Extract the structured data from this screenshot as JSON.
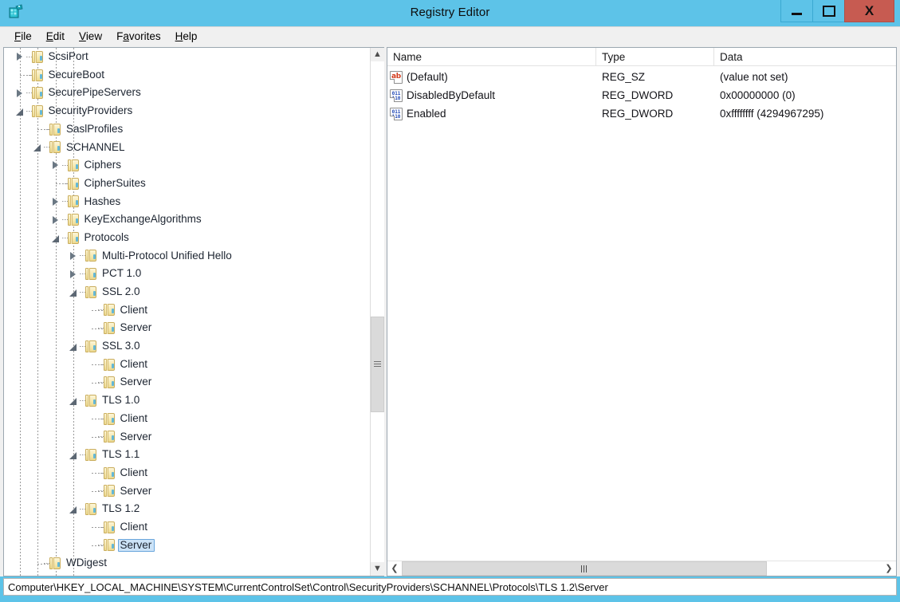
{
  "window": {
    "title": "Registry Editor",
    "app_icon": "regedit-icon",
    "controls": {
      "minimize": "minimize-button",
      "maximize": "maximize-button",
      "close": "X"
    },
    "accent_color": "#5dc3e8",
    "close_color": "#c75b51"
  },
  "menubar": {
    "items": [
      {
        "label": "File",
        "accel": "F"
      },
      {
        "label": "Edit",
        "accel": "E"
      },
      {
        "label": "View",
        "accel": "V"
      },
      {
        "label": "Favorites",
        "accel": "a"
      },
      {
        "label": "Help",
        "accel": "H"
      }
    ]
  },
  "tree": {
    "nodes": [
      {
        "label": "ScsiPort",
        "depth": 3,
        "state": "collapsed",
        "selected": false
      },
      {
        "label": "SecureBoot",
        "depth": 3,
        "state": "leaf",
        "selected": false
      },
      {
        "label": "SecurePipeServers",
        "depth": 3,
        "state": "collapsed",
        "selected": false
      },
      {
        "label": "SecurityProviders",
        "depth": 3,
        "state": "expanded",
        "selected": false
      },
      {
        "label": "SaslProfiles",
        "depth": 4,
        "state": "leaf",
        "selected": false
      },
      {
        "label": "SCHANNEL",
        "depth": 4,
        "state": "expanded",
        "selected": false
      },
      {
        "label": "Ciphers",
        "depth": 5,
        "state": "collapsed",
        "selected": false
      },
      {
        "label": "CipherSuites",
        "depth": 5,
        "state": "leaf",
        "selected": false
      },
      {
        "label": "Hashes",
        "depth": 5,
        "state": "collapsed",
        "selected": false
      },
      {
        "label": "KeyExchangeAlgorithms",
        "depth": 5,
        "state": "collapsed",
        "selected": false
      },
      {
        "label": "Protocols",
        "depth": 5,
        "state": "expanded",
        "selected": false
      },
      {
        "label": "Multi-Protocol Unified Hello",
        "depth": 6,
        "state": "collapsed",
        "selected": false
      },
      {
        "label": "PCT 1.0",
        "depth": 6,
        "state": "collapsed",
        "selected": false
      },
      {
        "label": "SSL 2.0",
        "depth": 6,
        "state": "expanded",
        "selected": false
      },
      {
        "label": "Client",
        "depth": 7,
        "state": "leaf",
        "selected": false
      },
      {
        "label": "Server",
        "depth": 7,
        "state": "leaf",
        "selected": false
      },
      {
        "label": "SSL 3.0",
        "depth": 6,
        "state": "expanded",
        "selected": false
      },
      {
        "label": "Client",
        "depth": 7,
        "state": "leaf",
        "selected": false
      },
      {
        "label": "Server",
        "depth": 7,
        "state": "leaf",
        "selected": false
      },
      {
        "label": "TLS 1.0",
        "depth": 6,
        "state": "expanded",
        "selected": false
      },
      {
        "label": "Client",
        "depth": 7,
        "state": "leaf",
        "selected": false
      },
      {
        "label": "Server",
        "depth": 7,
        "state": "leaf",
        "selected": false
      },
      {
        "label": "TLS 1.1",
        "depth": 6,
        "state": "expanded",
        "selected": false
      },
      {
        "label": "Client",
        "depth": 7,
        "state": "leaf",
        "selected": false
      },
      {
        "label": "Server",
        "depth": 7,
        "state": "leaf",
        "selected": false
      },
      {
        "label": "TLS 1.2",
        "depth": 6,
        "state": "expanded",
        "selected": false
      },
      {
        "label": "Client",
        "depth": 7,
        "state": "leaf",
        "selected": false
      },
      {
        "label": "Server",
        "depth": 7,
        "state": "leaf",
        "selected": true
      },
      {
        "label": "WDigest",
        "depth": 4,
        "state": "leaf",
        "selected": false
      }
    ],
    "scrollbar": {
      "up_arrow": "˄",
      "down_arrow": "˅",
      "thumb_top_pct": 51,
      "thumb_height_pct": 19
    }
  },
  "list": {
    "columns": [
      {
        "label": "Name"
      },
      {
        "label": "Type"
      },
      {
        "label": "Data"
      }
    ],
    "rows": [
      {
        "icon": "string-value-icon",
        "icon_kind": "sz",
        "name": "(Default)",
        "type": "REG_SZ",
        "data": "(value not set)"
      },
      {
        "icon": "dword-value-icon",
        "icon_kind": "dword",
        "name": "DisabledByDefault",
        "type": "REG_DWORD",
        "data": "0x00000000 (0)"
      },
      {
        "icon": "dword-value-icon",
        "icon_kind": "dword",
        "name": "Enabled",
        "type": "REG_DWORD",
        "data": "0xffffffff (4294967295)"
      }
    ],
    "scrollbar": {
      "left_arrow": "‹",
      "right_arrow": "›",
      "grip": "III"
    }
  },
  "statusbar": {
    "path": "Computer\\HKEY_LOCAL_MACHINE\\SYSTEM\\CurrentControlSet\\Control\\SecurityProviders\\SCHANNEL\\Protocols\\TLS 1.2\\Server"
  }
}
